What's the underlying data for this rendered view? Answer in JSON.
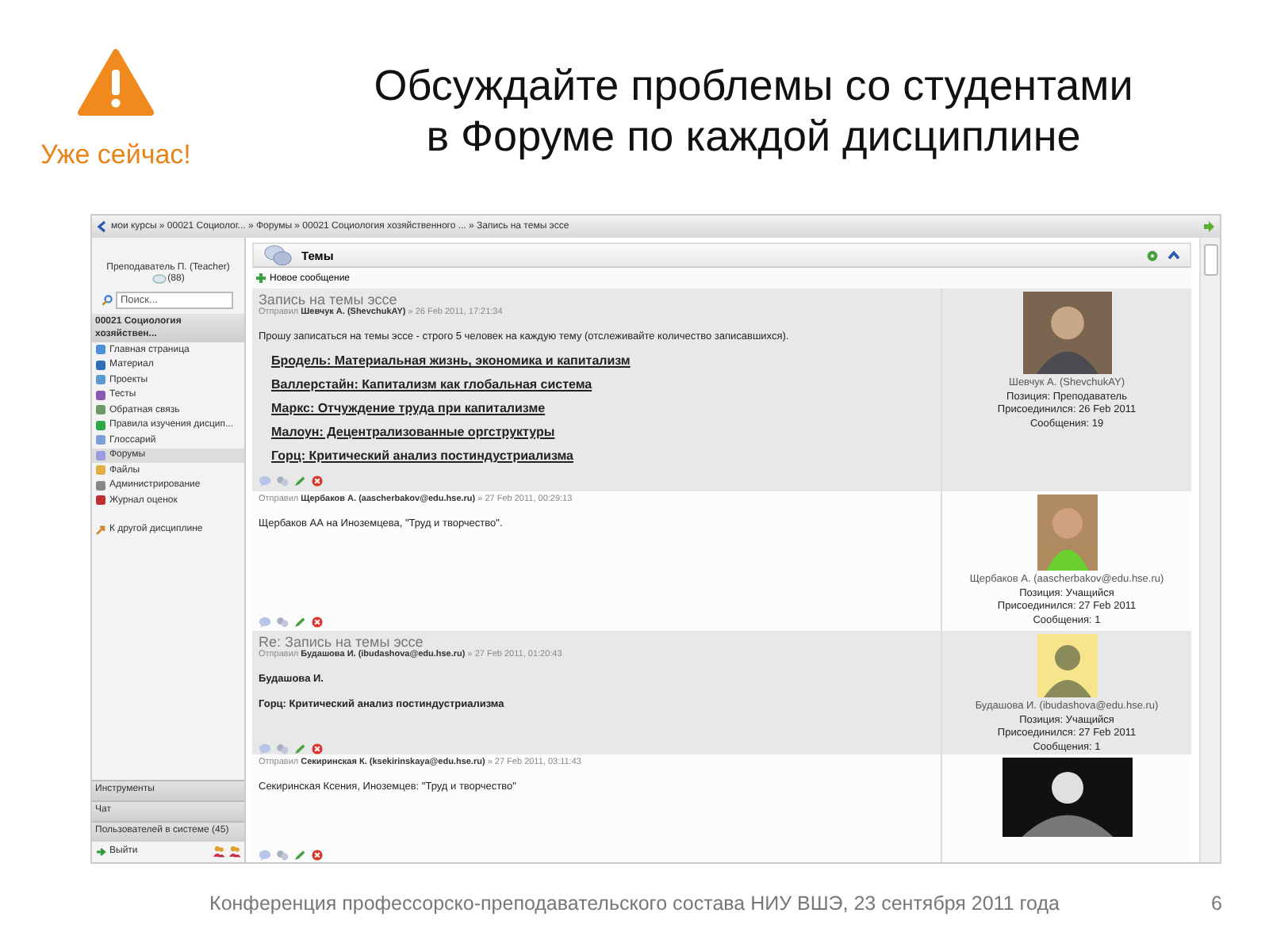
{
  "slide": {
    "title_lines": [
      "Обсуждайте проблемы со студентами",
      "в Форуме по каждой дисциплине"
    ],
    "subtitle": "Уже сейчас!",
    "footer": "Конференция профессорско-преподавательского состава НИУ ВШЭ, 23  сентября 2011 года",
    "page_number": "6"
  },
  "screen": {
    "breadcrumb": "мои курсы » 00021 Социолог... » Форумы » 00021 Социология хозяйственного ... » Запись на темы эссе",
    "sidebar": {
      "user": "Преподаватель П. (Teacher)",
      "messages": "(88)",
      "search": {
        "placeholder": "Поиск..."
      },
      "course": "00021 Социология хозяйствен...",
      "items": [
        {
          "label": "Главная страница",
          "selected": false
        },
        {
          "label": "Материал",
          "selected": false
        },
        {
          "label": "Проекты",
          "selected": false
        },
        {
          "label": "Тесты",
          "selected": false
        },
        {
          "label": "Обратная связь",
          "selected": false
        },
        {
          "label": "Правила изучения дисцип...",
          "selected": false
        },
        {
          "label": "Глоссарий",
          "selected": false
        },
        {
          "label": "Форумы",
          "selected": true
        },
        {
          "label": "Файлы",
          "selected": false
        },
        {
          "label": "Администрирование",
          "selected": false
        },
        {
          "label": "Журнал оценок",
          "selected": false
        }
      ],
      "other_course": "К другой дисциплине",
      "blocks": [
        "Инструменты",
        "Чат",
        "Пользователей в системе  (45)"
      ],
      "logout": "Выйти"
    },
    "forum": {
      "title": "Темы",
      "new_post": "Новое сообщение",
      "posts": [
        {
          "shaded": true,
          "subject": "Запись на темы эссе",
          "meta": "Отправил **Шевчук А. (ShevchukAY)** » 26 Feb 2011, 17:21:34",
          "body": [
            {
              "kind": "text",
              "text": "Прошу записаться на темы эссе - строго 5 человек на каждую тему (отслеживайте количество записавшихся)."
            },
            {
              "kind": "links",
              "items": [
                "Бродель: Материальная жизнь, экономика и капитализм",
                "Валлерстайн: Капитализм как глобальная система",
                "Маркс: Отчуждение труда при капитализме",
                "Малоун: Децентрализованные оргструктуры",
                "Горц: Критический анализ постиндустриализма"
              ]
            }
          ],
          "avatar": {
            "kind": "photo"
          },
          "profile": [
            "Шевчук А. (ShevchukAY)",
            "Позиция: Преподаватель",
            "Присоединился: 26 Feb 2011",
            "Сообщения: 19"
          ]
        },
        {
          "shaded": false,
          "meta": "Отправил **Щербаков А. (aascherbakov@edu.hse.ru)** » 27 Feb 2011, 00:29:13",
          "body": [
            {
              "kind": "text",
              "text": "Щербаков АА на Иноземцева, \"Труд и творчество\"."
            }
          ],
          "avatar": {
            "kind": "photo"
          },
          "profile": [
            "Щербаков А. (aascherbakov@edu.hse.ru)",
            "Позиция: Учащийся",
            "Присоединился: 27 Feb 2011",
            "Сообщения: 1"
          ]
        },
        {
          "shaded": true,
          "subject": "Re: Запись на темы эссе",
          "meta": "Отправил **Будашова И. (ibudashova@edu.hse.ru)** » 27 Feb 2011, 01:20:43",
          "body": [
            {
              "kind": "bold",
              "text": "Будашова И."
            },
            {
              "kind": "bold",
              "text": "Горц: Критический анализ постиндустриализма"
            }
          ],
          "avatar": {
            "kind": "default"
          },
          "profile": [
            "Будашова И. (ibudashova@edu.hse.ru)",
            "Позиция: Учащийся",
            "Присоединился: 27 Feb 2011",
            "Сообщения: 1"
          ]
        },
        {
          "shaded": false,
          "meta": "Отправил **Секиринская К. (ksekirinskaya@edu.hse.ru)** » 27 Feb 2011, 03:11:43",
          "body": [
            {
              "kind": "text",
              "text": "Секиринская Ксения, Иноземцев: \"Труд и творчество\""
            }
          ],
          "avatar": {
            "kind": "photo"
          }
        }
      ]
    }
  }
}
